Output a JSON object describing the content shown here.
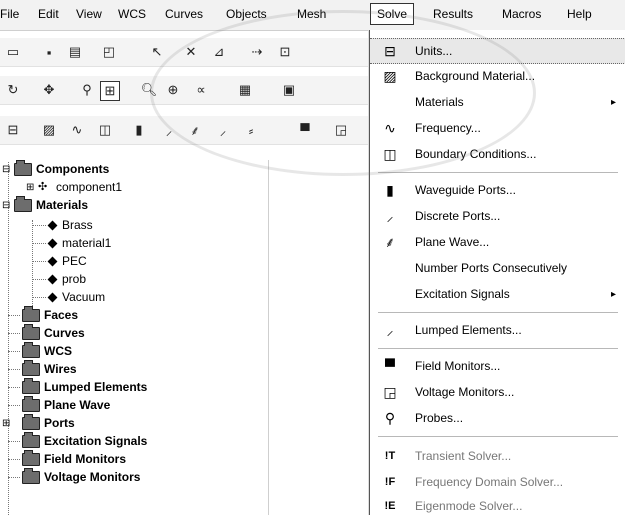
{
  "menubar": {
    "items": [
      "File",
      "Edit",
      "View",
      "WCS",
      "Curves",
      "Objects",
      "Mesh",
      "Solve",
      "Results",
      "Macros",
      "Help"
    ],
    "active": "Solve"
  },
  "tree": {
    "items": [
      {
        "label": "Components",
        "level": 0,
        "expander": "-",
        "icon": "folder-icon"
      },
      {
        "label": "component1",
        "level": 1,
        "expander": "+",
        "icon": "component-icon"
      },
      {
        "label": "Materials",
        "level": 0,
        "expander": "-",
        "icon": "folder-icon"
      },
      {
        "label": "Brass",
        "level": 1,
        "icon": "material-icon"
      },
      {
        "label": "material1",
        "level": 1,
        "icon": "material-icon"
      },
      {
        "label": "PEC",
        "level": 1,
        "icon": "material-icon"
      },
      {
        "label": "prob",
        "level": 1,
        "icon": "material-icon"
      },
      {
        "label": "Vacuum",
        "level": 1,
        "icon": "material-icon"
      },
      {
        "label": "Faces",
        "level": 0,
        "icon": "folder-icon"
      },
      {
        "label": "Curves",
        "level": 0,
        "icon": "folder-icon"
      },
      {
        "label": "WCS",
        "level": 0,
        "icon": "folder-icon"
      },
      {
        "label": "Wires",
        "level": 0,
        "icon": "folder-icon"
      },
      {
        "label": "Lumped Elements",
        "level": 0,
        "icon": "folder-icon"
      },
      {
        "label": "Plane Wave",
        "level": 0,
        "icon": "folder-icon"
      },
      {
        "label": "Ports",
        "level": 0,
        "expander": "+",
        "icon": "folder-icon"
      },
      {
        "label": "Excitation Signals",
        "level": 0,
        "icon": "folder-icon"
      },
      {
        "label": "Field Monitors",
        "level": 0,
        "icon": "folder-icon"
      },
      {
        "label": "Voltage Monitors",
        "level": 0,
        "icon": "folder-icon"
      }
    ]
  },
  "solve_menu": {
    "items": [
      {
        "label": "Units...",
        "icon": "units-icon",
        "selected": true
      },
      {
        "label": "Background Material...",
        "icon": "background-material-icon"
      },
      {
        "label": "Materials",
        "submenu": true
      },
      {
        "label": "Frequency...",
        "icon": "frequency-icon"
      },
      {
        "label": "Boundary Conditions...",
        "icon": "boundary-conditions-icon"
      },
      {
        "separator": true
      },
      {
        "label": "Waveguide Ports...",
        "icon": "waveguide-port-icon"
      },
      {
        "label": "Discrete Ports...",
        "icon": "discrete-port-icon"
      },
      {
        "label": "Plane Wave...",
        "icon": "plane-wave-icon"
      },
      {
        "label": "Number Ports Consecutively"
      },
      {
        "label": "Excitation Signals",
        "submenu": true
      },
      {
        "separator": true
      },
      {
        "label": "Lumped Elements...",
        "icon": "lumped-element-icon"
      },
      {
        "separator": true
      },
      {
        "label": "Field Monitors...",
        "icon": "field-monitor-icon"
      },
      {
        "label": "Voltage Monitors...",
        "icon": "voltage-monitor-icon"
      },
      {
        "label": "Probes...",
        "icon": "probe-icon"
      },
      {
        "separator": true
      },
      {
        "label": "Transient Solver...",
        "icon": "transient-solver-icon",
        "disabled": true
      },
      {
        "label": "Frequency Domain Solver...",
        "icon": "frequency-solver-icon",
        "disabled": true
      },
      {
        "label": "Eigenmode Solver...",
        "icon": "eigenmode-solver-icon",
        "disabled": true
      }
    ],
    "submenu_arrow": "▸"
  },
  "icons": {
    "folder": "▭",
    "units": "⊟",
    "frequency": "∿",
    "transient_prefix": "!T",
    "frequency_prefix": "!F",
    "eigen_prefix": "!E"
  }
}
